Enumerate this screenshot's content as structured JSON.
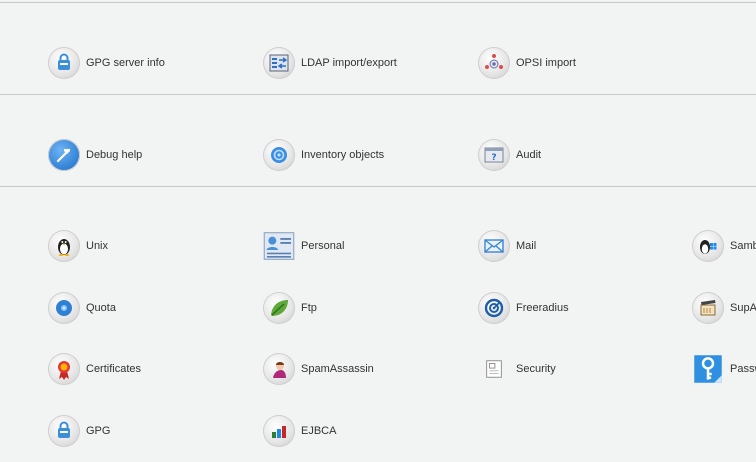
{
  "items": {
    "gpg_server_info": {
      "label": "GPG server info",
      "icon": "gpg-lock-icon"
    },
    "ldap_import_export": {
      "label": "LDAP import/export",
      "icon": "ldap-transfer-icon"
    },
    "opsi_import": {
      "label": "OPSI import",
      "icon": "opsi-icon"
    },
    "debug_help": {
      "label": "Debug help",
      "icon": "hammer-icon"
    },
    "inventory_objects": {
      "label": "Inventory objects",
      "icon": "inventory-icon"
    },
    "audit": {
      "label": "Audit",
      "icon": "audit-question-icon"
    },
    "unix": {
      "label": "Unix",
      "icon": "penguin-icon"
    },
    "personal": {
      "label": "Personal",
      "icon": "id-card-icon"
    },
    "mail": {
      "label": "Mail",
      "icon": "envelope-icon"
    },
    "samba": {
      "label": "Samba",
      "icon": "penguin-windows-icon"
    },
    "quota": {
      "label": "Quota",
      "icon": "disk-icon"
    },
    "ftp": {
      "label": "Ftp",
      "icon": "leaf-icon"
    },
    "freeradius": {
      "label": "Freeradius",
      "icon": "radius-target-icon"
    },
    "suparts": {
      "label": "SupAr",
      "icon": "clapper-icon"
    },
    "certificates": {
      "label": "Certificates",
      "icon": "certificate-seal-icon"
    },
    "spamassassin": {
      "label": "SpamAssassin",
      "icon": "spamassassin-icon"
    },
    "security": {
      "label": "Security",
      "icon": "security-document-icon"
    },
    "password": {
      "label": "Passw",
      "icon": "key-icon"
    },
    "gpg": {
      "label": "GPG",
      "icon": "gpg-lock-icon"
    },
    "ejbca": {
      "label": "EJBCA",
      "icon": "bar-blocks-icon"
    }
  }
}
